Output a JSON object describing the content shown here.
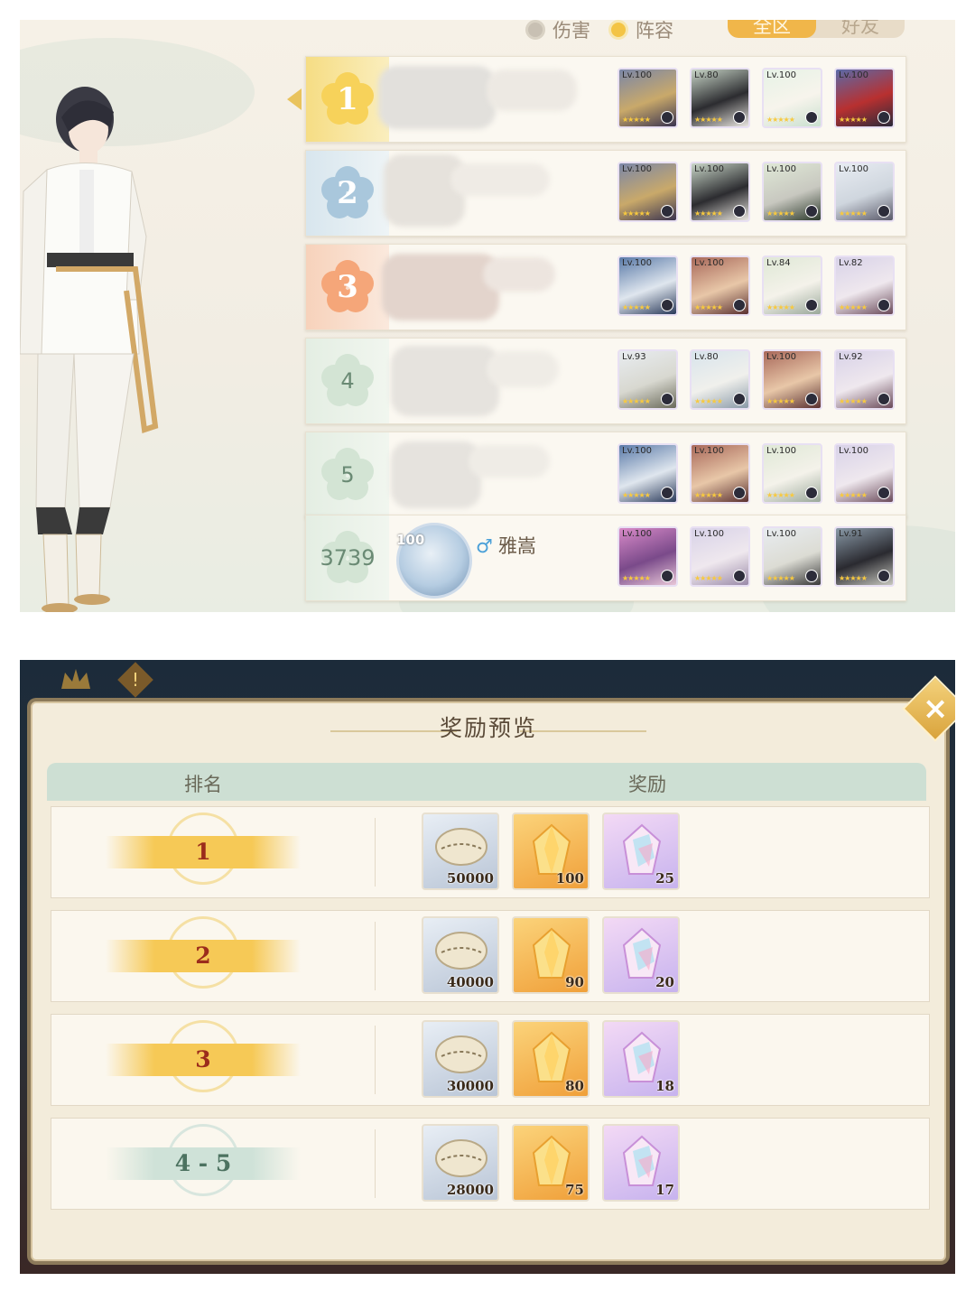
{
  "ranking": {
    "filters": [
      {
        "label": "伤害",
        "selected": false
      },
      {
        "label": "阵容",
        "selected": true
      }
    ],
    "scope_tabs": [
      {
        "label": "全区",
        "active": true
      },
      {
        "label": "好友",
        "active": false
      }
    ],
    "rows": [
      {
        "rank": "1",
        "tier": "gold",
        "heroes": [
          {
            "lv": "Lv.100"
          },
          {
            "lv": "Lv.80"
          },
          {
            "lv": "Lv.100"
          },
          {
            "lv": "Lv.100"
          }
        ]
      },
      {
        "rank": "2",
        "tier": "silver",
        "heroes": [
          {
            "lv": "Lv.100"
          },
          {
            "lv": "Lv.100"
          },
          {
            "lv": "Lv.100"
          },
          {
            "lv": "Lv.100"
          }
        ]
      },
      {
        "rank": "3",
        "tier": "bronze",
        "heroes": [
          {
            "lv": "Lv.100"
          },
          {
            "lv": "Lv.100"
          },
          {
            "lv": "Lv.84"
          },
          {
            "lv": "Lv.82"
          }
        ]
      },
      {
        "rank": "4",
        "tier": "green",
        "heroes": [
          {
            "lv": "Lv.93"
          },
          {
            "lv": "Lv.80"
          },
          {
            "lv": "Lv.100"
          },
          {
            "lv": "Lv.92"
          }
        ]
      },
      {
        "rank": "5",
        "tier": "green",
        "heroes": [
          {
            "lv": "Lv.100"
          },
          {
            "lv": "Lv.100"
          },
          {
            "lv": "Lv.100"
          },
          {
            "lv": "Lv.100"
          }
        ]
      }
    ],
    "my_row": {
      "rank": "3739",
      "player_level": "100",
      "player_gender": "♂",
      "player_name": "雅嵩",
      "heroes": [
        {
          "lv": "Lv.100"
        },
        {
          "lv": "Lv.100"
        },
        {
          "lv": "Lv.100"
        },
        {
          "lv": "Lv.91"
        }
      ]
    }
  },
  "reward_preview": {
    "title": "奖励预览",
    "close_icon": "close-icon",
    "headers": {
      "rank": "排名",
      "reward": "奖励"
    },
    "rows": [
      {
        "rank": "1",
        "style": "gold",
        "items": [
          {
            "type": "shell",
            "qty": "50000"
          },
          {
            "type": "gold-crystal",
            "qty": "100"
          },
          {
            "type": "rainbow-crystal",
            "qty": "25"
          }
        ]
      },
      {
        "rank": "2",
        "style": "gold",
        "items": [
          {
            "type": "shell",
            "qty": "40000"
          },
          {
            "type": "gold-crystal",
            "qty": "90"
          },
          {
            "type": "rainbow-crystal",
            "qty": "20"
          }
        ]
      },
      {
        "rank": "3",
        "style": "gold",
        "items": [
          {
            "type": "shell",
            "qty": "30000"
          },
          {
            "type": "gold-crystal",
            "qty": "80"
          },
          {
            "type": "rainbow-crystal",
            "qty": "18"
          }
        ]
      },
      {
        "rank": "4 - 5",
        "style": "teal",
        "items": [
          {
            "type": "shell",
            "qty": "28000"
          },
          {
            "type": "gold-crystal",
            "qty": "75"
          },
          {
            "type": "rainbow-crystal",
            "qty": "17"
          }
        ]
      }
    ]
  },
  "colors": {
    "gold": "#f6c956",
    "accent_red": "#9b2c1c",
    "teal": "#cfe2d8"
  }
}
